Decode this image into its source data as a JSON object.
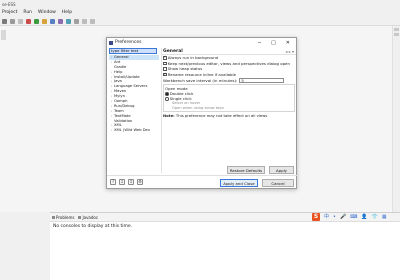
{
  "app": {
    "title": "se-ESS",
    "menu": [
      "Project",
      "Run",
      "Window",
      "Help"
    ]
  },
  "dialog": {
    "title": "Preferences",
    "filter_value": "type filter text",
    "tree": [
      {
        "label": "General",
        "selected": true
      },
      {
        "label": "Ant"
      },
      {
        "label": "Gradle"
      },
      {
        "label": "Help"
      },
      {
        "label": "Install/Update"
      },
      {
        "label": "Java"
      },
      {
        "label": "Language Servers"
      },
      {
        "label": "Maven"
      },
      {
        "label": "Mylyn"
      },
      {
        "label": "Oomph"
      },
      {
        "label": "Run/Debug"
      },
      {
        "label": "Team"
      },
      {
        "label": "TextMate"
      },
      {
        "label": "Validation"
      },
      {
        "label": "XML"
      },
      {
        "label": "XML (Wild Web Dev"
      }
    ],
    "page_title": "General",
    "options": [
      {
        "label": "Always run in background",
        "checked": true
      },
      {
        "label": "Keep next/previous editor, views and perspectives dialog open",
        "checked": false
      },
      {
        "label": "Show heap status",
        "checked": false
      },
      {
        "label": "Rename resource inline if available",
        "checked": true
      }
    ],
    "save_interval_label": "Workbench save interval (in minutes):",
    "save_interval_value": "5",
    "open_mode": {
      "label": "Open mode",
      "double_click": "Double click",
      "single_click": "Single click",
      "select_on_hover": "Select on hover",
      "open_when_arrow_keys": "Open when using arrow keys"
    },
    "note_label": "Note:",
    "note_text": "This preference may not take effect on all views",
    "buttons": {
      "restore_defaults": "Restore Defaults",
      "apply": "Apply",
      "apply_close": "Apply and Close",
      "cancel": "Cancel"
    }
  },
  "bottom_panel": {
    "tabs": [
      "Problems",
      "Javadoc"
    ],
    "message": "No consoles to display at this time."
  },
  "colors": {
    "accent": "#3c78d8",
    "selection": "#cde3f7",
    "sogou": "#e8521e"
  }
}
